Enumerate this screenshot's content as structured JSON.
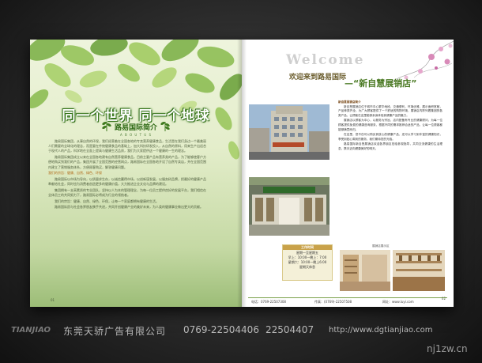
{
  "left_page": {
    "title": "同一个世界 同一个地球",
    "subtitle": "路易国际简介",
    "subtitle_en": "A B O U T U S",
    "paragraphs": [
      "路易国际集团，从事自然的环保，我们经营着在全国各地的专卖营养健康食品，生活是在我们身边一个最美丽人们需要的全球化的理念，而是要在传统健康食品的基础上，加大科技研发投入，从自然的原料，用来生产出适合于现代人的产品，科学地在全面上提高与健康生活品质，我们为大家提供这一个健康的一生的理念。",
      "路易国际集团成立以来在全国各地建有自然营养健康食品，目前主要产品有营养类的产品，为了能够使客户方便地购买到我们的产品，集团开展了全国范围的经营网点，路易国际在全国各地开设了自然专卖店，并在全国范围内建立了营销服务体系，方便顾客购买，解答健康问题。",
      "路易国际以市场为导向，以质量求生存，以诚信赢得市场，以创新谋发展，以服务树品牌，把最好的健康产品奉献给社会，同时也为消费者创造更多的健康价值，大力推进企业文化与品牌的建设。",
      "集团拥有一支高素质的专业团队，坚持以人为本的管理理念，为每一位员工提供良好的发展平台，我们相信在全体员工的共同努力下，路易国际必将成为行业的领航者。",
      "我们的宗旨：健康、自然、绿色、环保，让每一个家庭都拥有健康的生活。",
      "路易国际愿与社会各界朋友携手共进，共同开创健康产业的美好未来，为人类的健康事业做出更大的贡献。"
    ],
    "highlight": "我们的宗旨：健康、自然、绿色、环保",
    "page_number": "01"
  },
  "right_page": {
    "welcome": "Welcome",
    "welcome_cn": "欢迎来到路易国际",
    "store_name": "—“新自慧展销店”",
    "section_heading": "新自慧展销店简介",
    "paragraphs": [
      "新自慧展销店位于城市中心繁华地段，交通便利，环境优雅，展示面积宽敞，产品种类齐全，为广大顾客提供了一个舒适的购物环境，展销店内陈列着集团的各类产品，让顾客在这里能够亲身体验到健康产品的魅力。",
      "展销店以顾客为中心，以服务为宗旨，店内配备有专业的健康顾问，为每一位顾客提供免费的健康咨询服务，根据不同的需求推荐合适的产品，让每一位顾客都能够满意而归。",
      "在这里，您不仅可以购买到放心的健康产品，还可以学习到丰富的健康知识，享受到贴心周到的服务，我们期待您的光临。",
      "路易国际新自慧展销店欢迎各界朋友莅临参观指导，共同交流健康的生活理念，携手迈向健康美好的明天。"
    ],
    "hours_title": "工作时间",
    "hours_lines": [
      "星期一至星期五",
      "早上：10:00—晚上：7:00",
      "星期六：10:00—晚上6:00",
      "星期天休息"
    ],
    "photo_caption": "展销店展示区",
    "footer_phone": "电话：0769-22507308",
    "footer_fax": "传真：(0769)-22507508",
    "footer_web": "网址：www.luyi.com",
    "page_number": "02"
  },
  "watermark": {
    "logo": "TIANJIAO",
    "company": "东莞天骄广告有限公司",
    "phone1": "0769-22504406",
    "phone2": "22504407",
    "url": "http://www.dgtianjiao.com",
    "site": "nj1zw.cn"
  },
  "colors": {
    "title_green": "#4b7a24",
    "footer_green": "#7aa04a",
    "dark_bg": "#2a2a2a"
  }
}
